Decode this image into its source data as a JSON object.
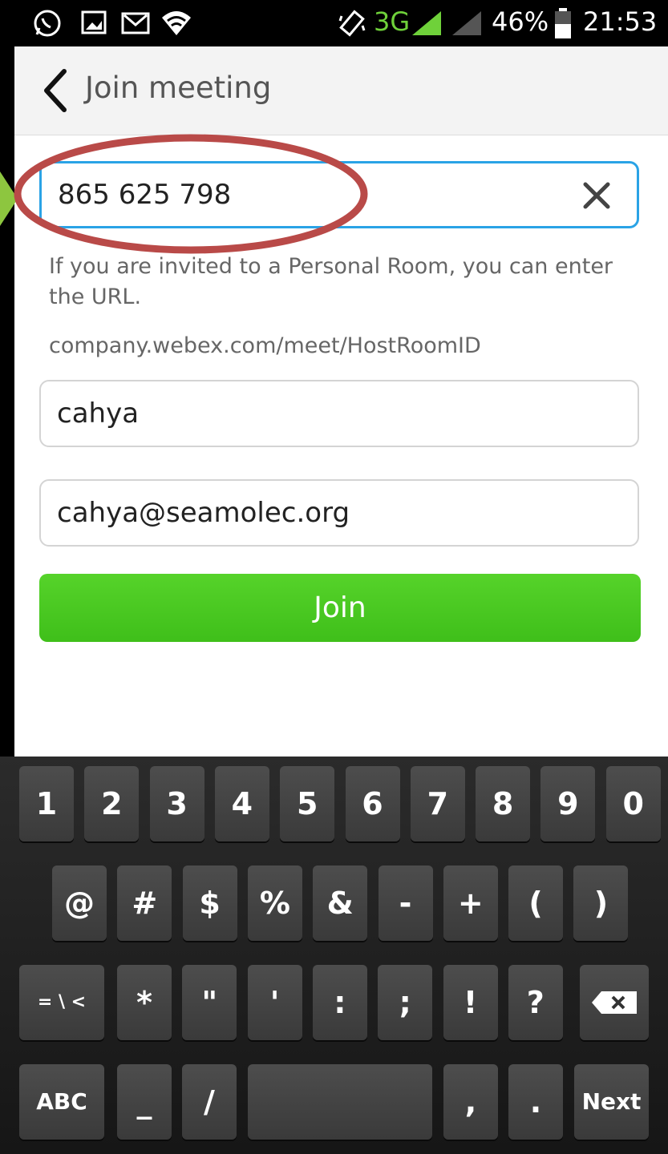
{
  "status_bar": {
    "network": "3G",
    "battery": "46%",
    "time": "21:53",
    "icons": [
      "whatsapp-icon",
      "gallery-icon",
      "gmail-icon",
      "wifi-icon",
      "vibrate-icon",
      "signal-icon",
      "battery-icon"
    ]
  },
  "header": {
    "title": "Join meeting",
    "back_icon": "chevron-left-icon"
  },
  "form": {
    "meeting_number": {
      "value": "865 625 798"
    },
    "hint_personal_room": "If you are invited to a Personal Room, you can enter the URL.",
    "hint_url_example": "company.webex.com/meet/HostRoomID",
    "name": {
      "value": "cahya"
    },
    "email": {
      "value": "cahya@seamolec.org"
    },
    "join_label": "Join"
  },
  "keyboard": {
    "row1": [
      "1",
      "2",
      "3",
      "4",
      "5",
      "6",
      "7",
      "8",
      "9",
      "0"
    ],
    "row2": [
      "@",
      "#",
      "$",
      "%",
      "&",
      "-",
      "+",
      "(",
      ")"
    ],
    "row3": [
      "= \\ <",
      "*",
      "\"",
      "'",
      ":",
      ";",
      "!",
      "?"
    ],
    "row4": [
      "ABC",
      "_",
      "/",
      ",",
      ".",
      "Next"
    ]
  },
  "colors": {
    "accent_focus": "#2aa3e6",
    "join_green": "#46c71f",
    "annotation_red": "#b94a48",
    "annotation_green": "#8dc63f"
  }
}
